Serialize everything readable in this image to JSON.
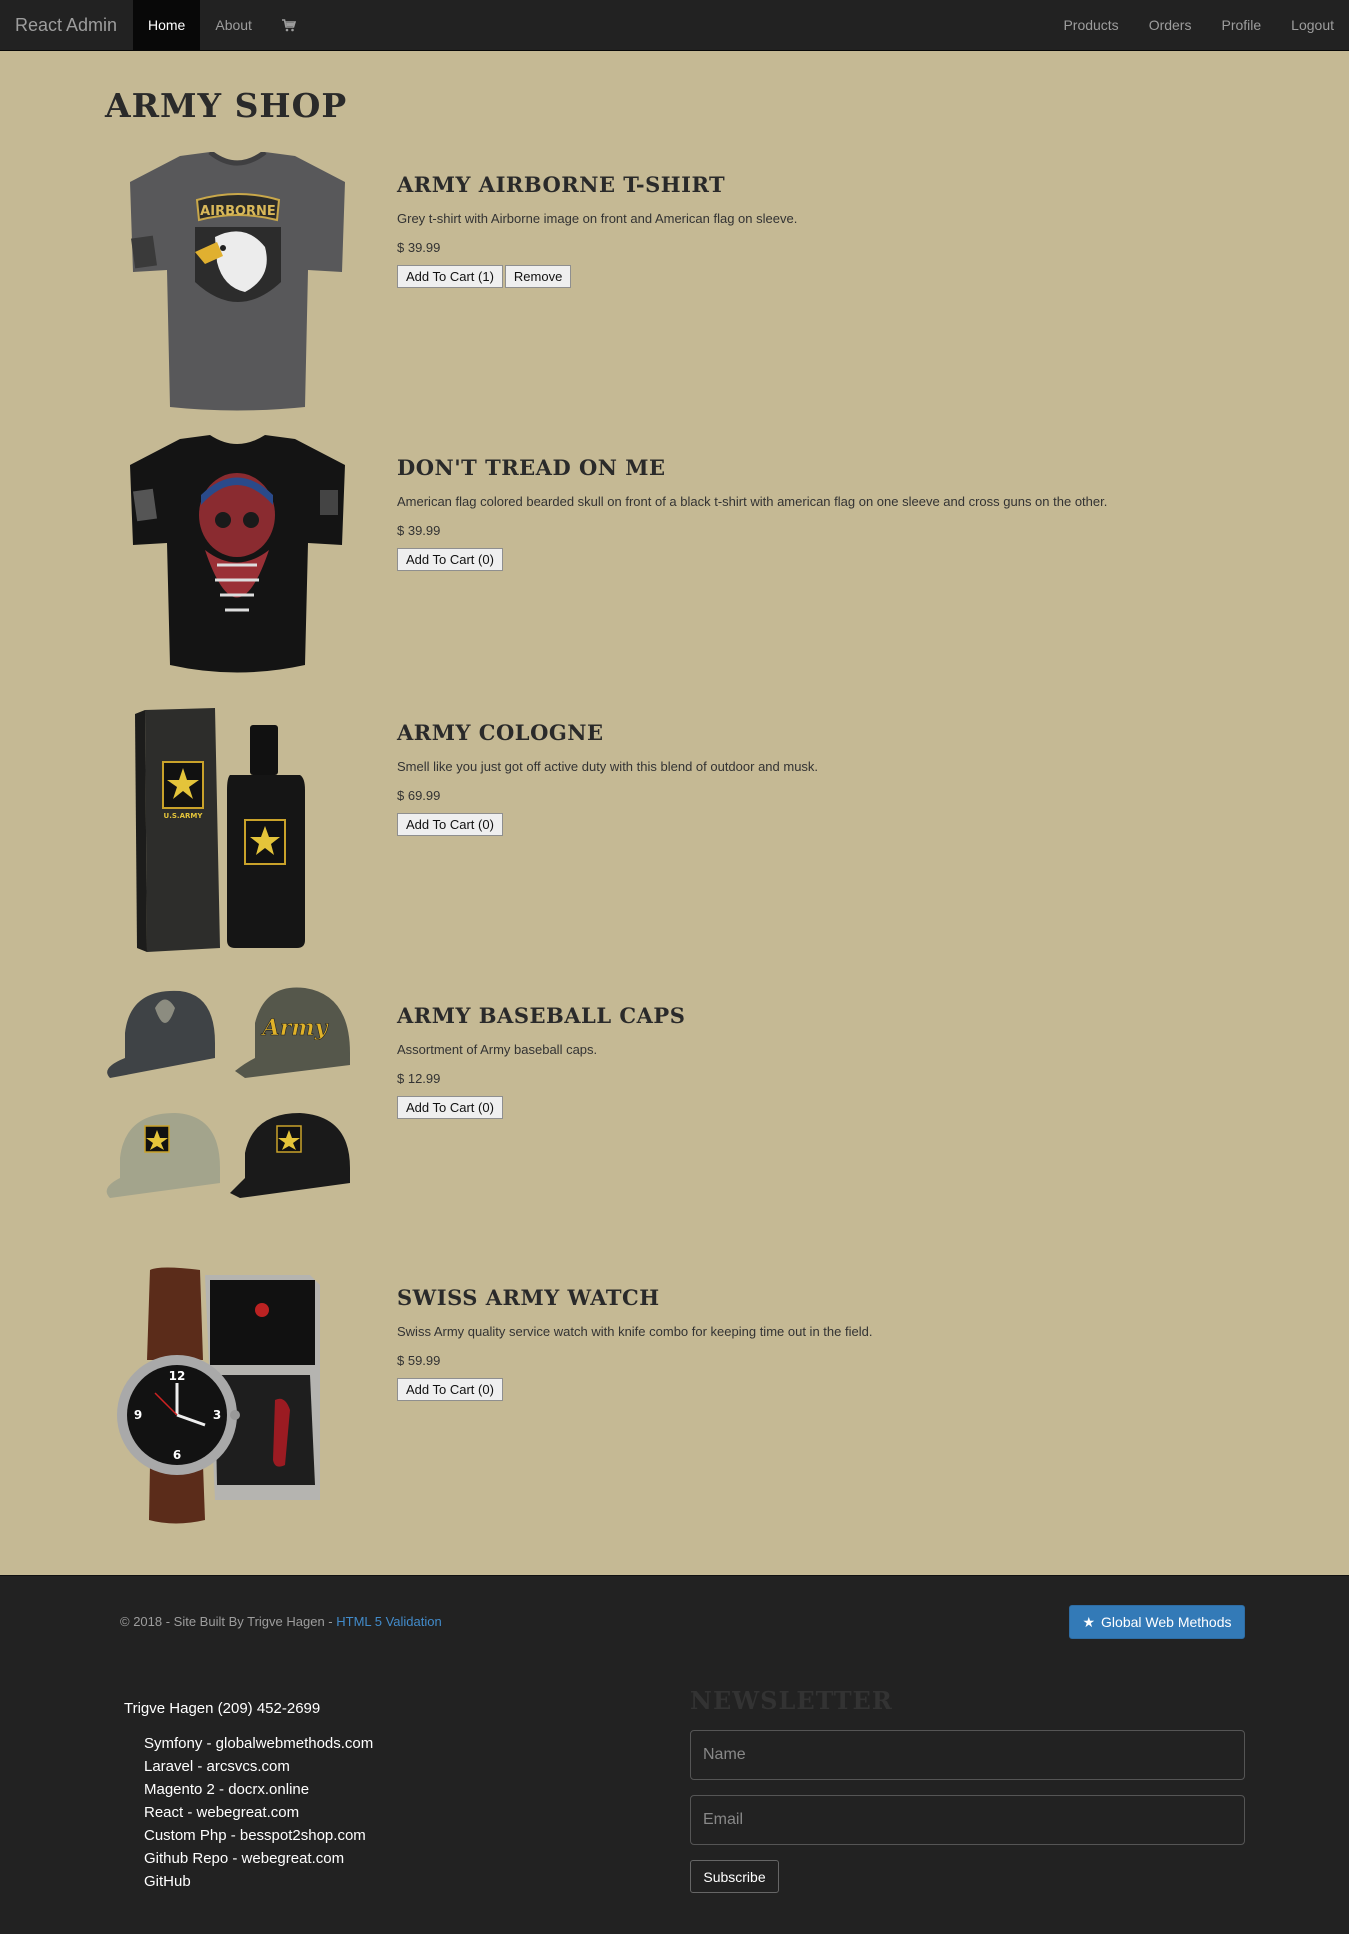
{
  "navbar": {
    "brand": "React Admin",
    "left_links": [
      "Home",
      "About"
    ],
    "cart_icon": "shopping-cart-icon",
    "right_links": [
      "Products",
      "Orders",
      "Profile",
      "Logout"
    ]
  },
  "shop": {
    "title": "ARMY SHOP",
    "products": [
      {
        "name": "ARMY AIRBORNE T-SHIRT",
        "description": "Grey t-shirt with Airborne image on front and American flag on sleeve.",
        "price": "$ 39.99",
        "add_label": "Add To Cart (1)",
        "remove_label": "Remove",
        "image_text": "AIRBORNE"
      },
      {
        "name": "DON'T TREAD ON ME",
        "description": "American flag colored bearded skull on front of a black t-shirt with american flag on one sleeve and cross guns on the other.",
        "price": "$ 39.99",
        "add_label": "Add To Cart (0)"
      },
      {
        "name": "ARMY COLOGNE",
        "description": "Smell like you just got off active duty with this blend of outdoor and musk.",
        "price": "$ 69.99",
        "add_label": "Add To Cart (0)",
        "image_text": "U.S.ARMY"
      },
      {
        "name": "ARMY BASEBALL CAPS",
        "description": "Assortment of Army baseball caps.",
        "price": "$ 12.99",
        "add_label": "Add To Cart (0)",
        "image_text": "Army"
      },
      {
        "name": "SWISS ARMY WATCH",
        "description": "Swiss Army quality service watch with knife combo for keeping time out in the field.",
        "price": "$ 59.99",
        "add_label": "Add To Cart (0)"
      }
    ]
  },
  "footer": {
    "copyright": "© 2018 - Site Built By Trigve Hagen - ",
    "validation_link": "HTML 5 Validation",
    "gwm_button": "Global Web Methods",
    "contact": "Trigve Hagen (209) 452-2699",
    "sites": [
      "Symfony - globalwebmethods.com",
      "Laravel - arcsvcs.com",
      "Magento 2 - docrx.online",
      "React - webegreat.com",
      "Custom Php - besspot2shop.com",
      "Github Repo - webegreat.com",
      "GitHub"
    ],
    "newsletter": {
      "title": "NEWSLETTER",
      "name_placeholder": "Name",
      "email_placeholder": "Email",
      "subscribe_label": "Subscribe"
    }
  },
  "colors": {
    "page_bg": "#c5b994",
    "nav_bg": "#222222",
    "link_blue": "#428bca",
    "button_blue": "#337ab7"
  }
}
